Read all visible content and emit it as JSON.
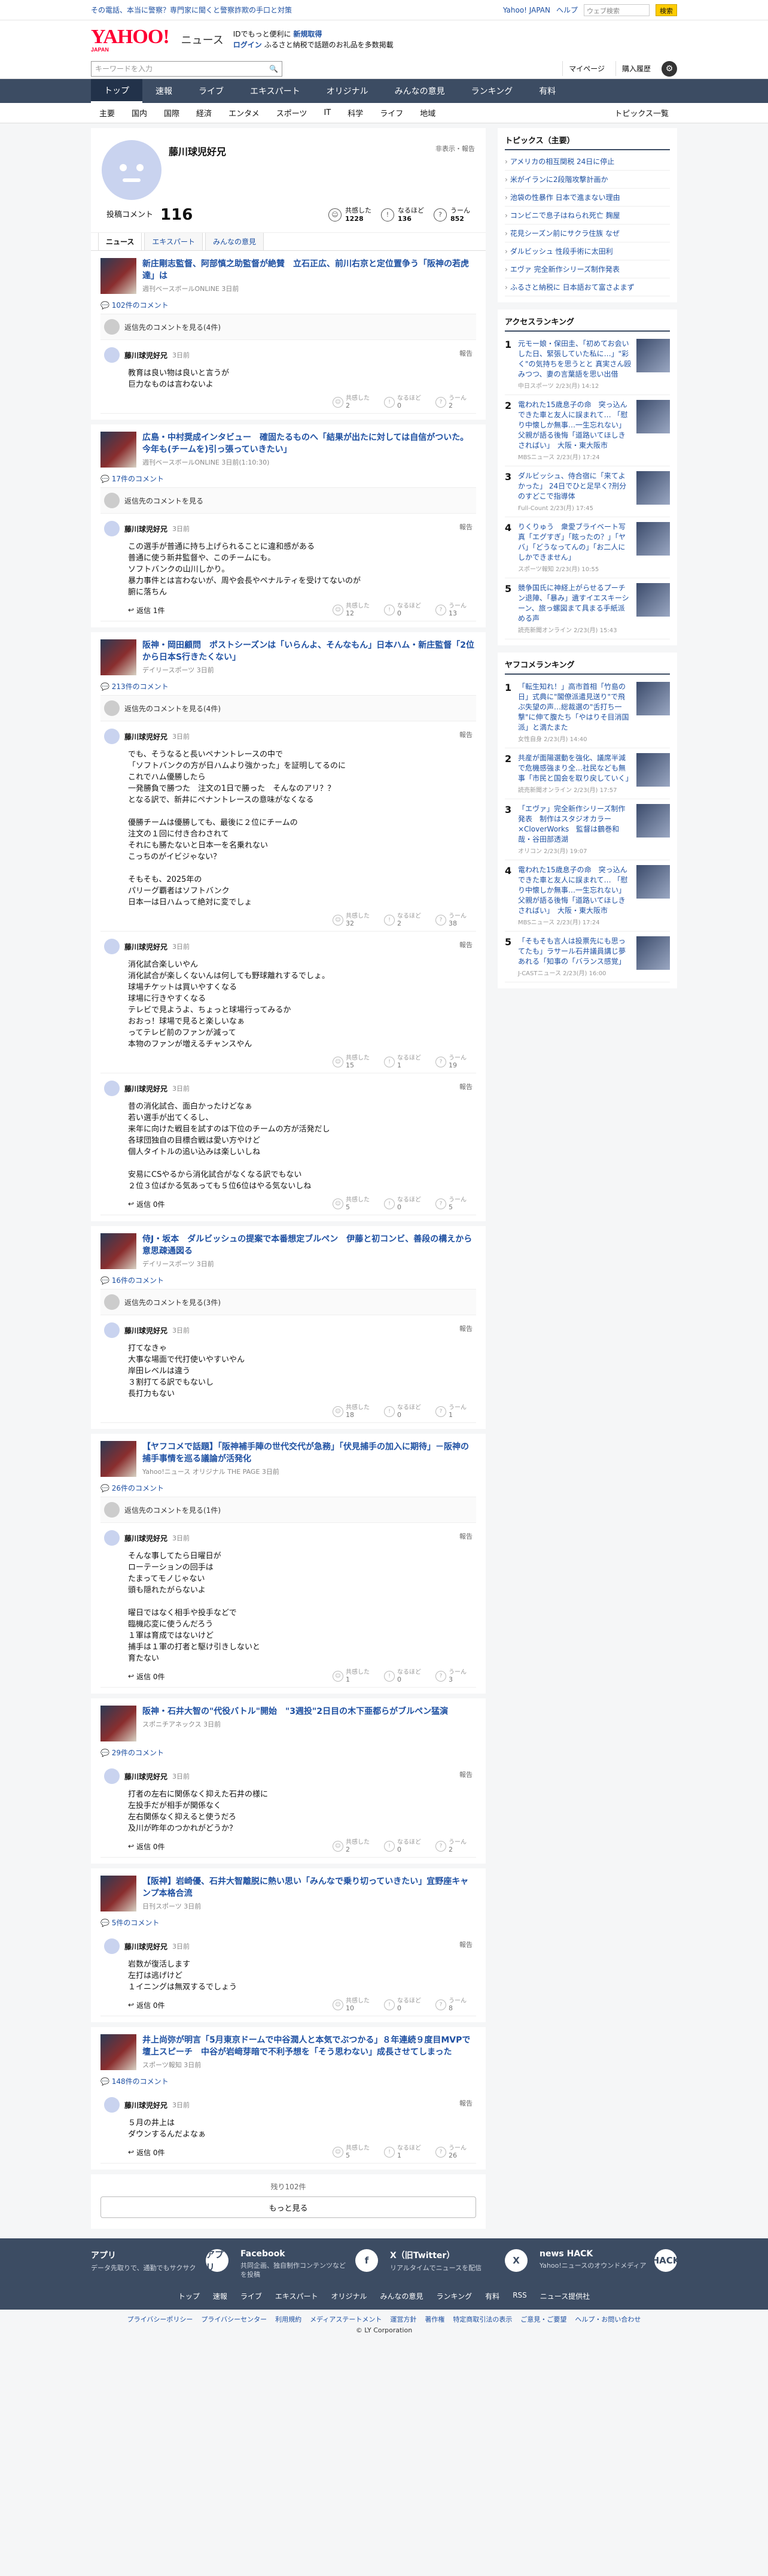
{
  "topbar": {
    "message": "その電話、本当に警察？専門家に聞くと警察詐欺の手口と対策",
    "yahoo_japan": "Yahoo! JAPAN",
    "help": "ヘルプ",
    "search_placeholder": "ウェブ検索",
    "search_button": "検索"
  },
  "header": {
    "logo": "YAHOO!",
    "logo_sub_small": "JAPAN",
    "site": "ニュース",
    "promo_line1_prefix": "IDでもっと便利に",
    "promo_line1_link": "新規取得",
    "promo_line2_link": "ログイン",
    "promo_line2_text": "ふるさと納税で話題のお礼品を多数掲載"
  },
  "searchbar": {
    "placeholder": "キーワードを入力",
    "mypage": "マイページ",
    "paid": "購入履歴"
  },
  "nav_main": [
    "トップ",
    "速報",
    "ライブ",
    "エキスパート",
    "オリジナル",
    "みんなの意見",
    "ランキング",
    "有料"
  ],
  "nav_sub": [
    "主要",
    "国内",
    "国際",
    "経済",
    "エンタメ",
    "スポーツ",
    "IT",
    "科学",
    "ライフ",
    "地域"
  ],
  "nav_sub_right": "トピックス一覧",
  "profile": {
    "name": "藤川球児好兄",
    "report": "非表示・報告",
    "comment_label": "投稿コメント",
    "comment_count": "116",
    "stat1_label": "共感した",
    "stat1_value": "1228",
    "stat2_label": "なるほど",
    "stat2_value": "136",
    "stat3_label": "うーん",
    "stat3_value": "852"
  },
  "tabs": [
    "ニュース",
    "エキスパート",
    "みんなの意見"
  ],
  "articles": [
    {
      "title": "新庄剛志監督、阿部慎之助監督が絶賛　立石正広、前川右京と定位置争う「阪神の若虎達」は",
      "source": "週刊ベースボールONLINE 3日前",
      "count": "102件のコメント",
      "others": "返信先のコメントを見る(4件)",
      "comments": [
        {
          "name": "藤川球児好兄",
          "time": "3日前",
          "report": "報告",
          "text": "教育は良い物は良いと言うが\n巨力なものは言わないよ",
          "reply": "",
          "r1": "2",
          "r2": "0",
          "r3": "2"
        }
      ]
    },
    {
      "title": "広島・中村奨成インタビュー　確固たるものへ「結果が出たに対しては自信がついた。今年も(チームを)引っ張っていきたい」",
      "source": "週刊ベースボールONLINE 3日前(1:10:30)",
      "count": "17件のコメント",
      "others": "返信先のコメントを見る",
      "comments": [
        {
          "name": "藤川球児好兄",
          "time": "3日前",
          "report": "報告",
          "text": "この選手が普通に持ち上げられることに違和感がある\n普通に使う新井監督や、このチームにも。\nソフトバンクの山川しかり。\n暴力事件とは言わないが、周や会長やペナルティを受けてないのが\n腑に落ちん",
          "reply": "返信 1件",
          "r1": "12",
          "r2": "0",
          "r3": "13"
        }
      ]
    },
    {
      "title": "阪神・岡田顧問　ポストシーズンは「いらんよ、そんなもん」日本ハム・新庄監督「2位から日本S行きたくない」",
      "source": "デイリースポーツ 3日前",
      "count": "213件のコメント",
      "others": "返信先のコメントを見る(4件)",
      "comments": [
        {
          "name": "藤川球児好兄",
          "time": "3日前",
          "report": "報告",
          "text": "でも、そうなると長いペナントレースの中で\n「ソフトバンクの方が日ハムより強かった」を証明してるのに\nこれでハム優勝したら\n一発勝負で勝つた　注文の1日で勝った　そんなのアリ？？\nとなる訳で、新井にペナントレースの意味がなくなる\n\n優勝チームは優勝しても、最後に２位にチームの\n注文の１回に付き合わされて\nそれにも勝たないと日本一を名乗れない\nこっちのがイビジゃない？\n\nそもそも、2025年の\nパリーグ覇者はソフトバンク\n日本一は日ハムって絶対に変でしょ",
          "reply": "",
          "r1": "32",
          "r2": "2",
          "r3": "38"
        },
        {
          "name": "藤川球児好兄",
          "time": "3日前",
          "report": "報告",
          "text": "消化試合楽しいやん\n消化試合が楽しくないんは何しても野球離れするでしょ。\n球場チケットは買いやすくなる\n球場に行きやすくなる\nテレビで見ようよ、ちょっと球場行ってみるか\nおおっ！球場で見ると楽しいなぁ\nってテレビ前のファンが減って\n本物のファンが増えるチャンスやん",
          "reply": "",
          "r1": "15",
          "r2": "1",
          "r3": "19"
        },
        {
          "name": "藤川球児好兄",
          "time": "3日前",
          "report": "報告",
          "text": "昔の消化試合、面白かったけどなぁ\n若い選手が出てくるし、\n来年に向けた戦目を試すのは下位のチームの方が活発だし\n各球団独自の目標合戦は愛い方やけど\n個人タイトルの追い込みは楽しいしね\n\n安易にCSやるから消化試合がなくなる訳でもない\n２位３位ばかる気あっても５位6位はやる気ないしね",
          "reply": "返信 0件",
          "r1": "5",
          "r2": "0",
          "r3": "5"
        }
      ]
    },
    {
      "title": "侍J・坂本　ダルビッシュの提案で本番想定ブルペン　伊藤と初コンビ、善段の構えから意思疎通図る",
      "source": "デイリースポーツ 3日前",
      "count": "16件のコメント",
      "others": "返信先のコメントを見る(3件)",
      "comments": [
        {
          "name": "藤川球児好兄",
          "time": "3日前",
          "report": "報告",
          "text": "打てなきゃ\n大事な場面で代打使いやすいやん\n岸田レベルは違う\n３割打てる訳でもないし\n長打力もない",
          "reply": "",
          "r1": "18",
          "r2": "0",
          "r3": "1"
        }
      ]
    },
    {
      "title": "【ヤフコメで話題】「阪神補手陣の世代交代が急務」「伏見捕手の加入に期待」－阪神の捕手事情を巡る議論が活発化",
      "source": "Yahoo!ニュース オリジナル THE PAGE 3日前",
      "count": "26件のコメント",
      "others": "返信先のコメントを見る(1件)",
      "comments": [
        {
          "name": "藤川球児好兄",
          "time": "3日前",
          "report": "報告",
          "text": "そんな事してたら日曜日が\nローテーションの回手は\nたまってモノじゃない\n頭も隠れたがらないよ\n\n曜日ではなく相手や投手などで\n臨機応変に使うんだろう\n１軍は育成ではないけど\n捕手は１軍の打者と駆け引きしないと\n育たない",
          "reply": "返信 0件",
          "r1": "1",
          "r2": "0",
          "r3": "3"
        }
      ]
    },
    {
      "title": "阪神・石井大智の\"代役バトル\"開始　\"3週投\"2日目の木下亜都らがブルペン猛演",
      "source": "スポニチアネックス 3日前",
      "count": "29件のコメント",
      "others": "",
      "comments": [
        {
          "name": "藤川球児好兄",
          "time": "3日前",
          "report": "報告",
          "text": "打者の左右に関係なく抑えた石井の様に\n左投手だが相手が関係なく\n左右関係なく抑えると使うだろ\n及川が昨年のつかれがどうか？",
          "reply": "返信 0件",
          "r1": "2",
          "r2": "0",
          "r3": "2"
        }
      ]
    },
    {
      "title": "【阪神】岩崎優、石井大智離脱に熱い思い「みんなで乗り切っていきたい」宜野座キャンプ本格合流",
      "source": "日刊スポーツ 3日前",
      "count": "5件のコメント",
      "others": "",
      "comments": [
        {
          "name": "藤川球児好兄",
          "time": "3日前",
          "report": "報告",
          "text": "岩数が復活します\n左打は逃げけど\n１イニングは無双するでしょう",
          "reply": "返信 0件",
          "r1": "10",
          "r2": "0",
          "r3": "8"
        }
      ]
    },
    {
      "title": "井上尚弥が明言「5月東京ドームで中谷潤人と本気でぶつかる」８年連続９度目MVPで壇上スピーチ　中谷が岩﨑芽暗で不利予想を「そう思わない」成長させてしまった",
      "source": "スポーツ報知 3日前",
      "count": "148件のコメント",
      "others": "",
      "comments": [
        {
          "name": "藤川球児好兄",
          "time": "3日前",
          "report": "報告",
          "text": "５月の井上は\nダウンするんだよなぁ",
          "reply": "返信 0件",
          "r1": "5",
          "r2": "1",
          "r3": "26"
        }
      ]
    }
  ],
  "pager": {
    "remaining": "残り102件",
    "button": "もっと見る"
  },
  "sidebar": {
    "topics_title": "トピックス（主要）",
    "topics": [
      {
        "t": "アメリカの相互関税 24日に停止"
      },
      {
        "t": "米がイランに2段階攻撃計画か"
      },
      {
        "t": "池袋の性暴作 日本で進まない理由"
      },
      {
        "t": "コンビニで息子はねられ死亡 麹屋"
      },
      {
        "t": "花見シーズン前にサクラ住族 なぜ"
      },
      {
        "t": "ダルビッシュ 性段手術に太田利"
      },
      {
        "t": "エヴァ 完全新作シリーズ制作発表"
      },
      {
        "t": "ふるさと納税に 日本語おて富さよまず"
      }
    ],
    "access_title": "アクセスランキング",
    "access": [
      {
        "t": "元モー娘・保田圭、「初めてお会いした日、緊張していた私に…」\"彩く\"の気持ちを思うとと 真実さん殴みつつ、妻の言葉語を思い出借",
        "s": "中日スポーツ 2/23(月) 14:12"
      },
      {
        "t": "電われた15歳息子の命　突っ込んできた車と友人に誤まれて… 「慰り中懐しか無事…一生忘れない」父親が語る後悔「道路いてほしきさればい」　大阪・東大阪市",
        "s": "MBSニュース 2/23(月) 17:24"
      },
      {
        "t": "ダルビッシュ、侍合宿に「来てよかった」 24日でひと足早く?刑分のすどこで指導体",
        "s": "Full-Count 2/23(月) 17:45"
      },
      {
        "t": "りくりゅう　衆愛ブライベート写真「エグすぎ」「眩ったの？」「ヤバ」「どうなってんの」「お二人にしかできません」",
        "s": "スポーツ報知 2/23(月) 10:55"
      },
      {
        "t": "競争国氏に神経上がらせるプーチン退陣、「暴み」遺すイエスキーシーン、旅っ螺図まて具まる手紙派める声",
        "s": "読売新聞オンライン 2/23(月) 15:43"
      }
    ],
    "yafuko_title": "ヤフコメランキング",
    "yafuko": [
      {
        "t": "「転生知れ！」高市首相「竹島の日」式典に\"閣僚派遣見送り\"で飛ぶ失望の声…総裁選の\"舌打ち一撃\"に伸て腹たち「やはりそ目消国派」と満たまた",
        "s": "女性自身 2/23(月) 14:40"
      },
      {
        "t": "共産が面陽選動を強化、議席半減で危機感強まり全…社民なども無事「市民と国会を取り戻していく」",
        "s": "読売新聞オンライン 2/23(月) 17:57"
      },
      {
        "t": "「エヴァ」完全新作シリーズ制作発表　制作はスタジオカラー×CloverWorks　監督は鶴巻和哉・谷田部透湖",
        "s": "オリコン 2/23(月) 19:07"
      },
      {
        "t": "電われた15歳息子の命　突っ込んできた車と友人に誤まれて… 「慰り中懐しか無事…一生忘れない」父親が語る後悔「道路いてほしきさればい」　大阪・東大阪市",
        "s": "MBSニュース 2/23(月) 17:24"
      },
      {
        "t": "「そもそも言人は投票先にも思ってたも」ラサール石井議員講じ夢あれる「知事の「バランス感覚」",
        "s": "J-CASTニュース 2/23(月) 16:00"
      }
    ]
  },
  "footer": {
    "cols": [
      {
        "title": "アプリ",
        "desc": "データ先取りで、通勤でもサクサク",
        "icon": "アプリ"
      },
      {
        "title": "Facebook",
        "desc": "共同企画、独自制作コンテンツなどを投稿",
        "icon": "f"
      },
      {
        "title": "X（旧Twitter）",
        "desc": "リアルタイムでニュースを配信",
        "icon": "X"
      },
      {
        "title": "news HACK",
        "desc": "Yahoo!ニュースのオウンドメディア",
        "icon": "HACK"
      }
    ],
    "nav": [
      "トップ",
      "速報",
      "ライブ",
      "エキスパート",
      "オリジナル",
      "みんなの意見",
      "ランキング",
      "有料",
      "RSS",
      "ニュース提供社"
    ],
    "legal": [
      "プライバシーポリシー",
      "プライバシーセンター",
      "利用規約",
      "メディアステートメント",
      "運営方針",
      "著作権",
      "特定商取引法の表示",
      "ご意見・ご要望",
      "ヘルプ・お問い合わせ"
    ],
    "copyright": "© LY Corporation"
  }
}
